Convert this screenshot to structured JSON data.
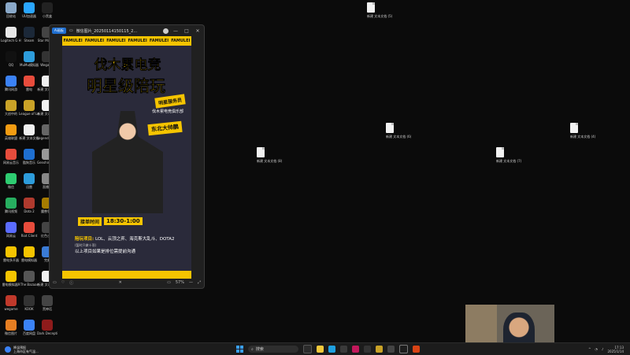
{
  "desktop": {
    "left_icons": [
      {
        "label": "回收站",
        "color": "#8aa9c9"
      },
      {
        "label": "UU加速器",
        "color": "#2aa6ff"
      },
      {
        "label": "小黑盒",
        "color": "#222222"
      },
      {
        "label": "Logitech G HUB",
        "color": "#e7e7e7"
      },
      {
        "label": "Steam",
        "color": "#1b2838"
      },
      {
        "label": "Star Millions",
        "color": "#444444"
      },
      {
        "label": "QQ",
        "color": "#111111"
      },
      {
        "label": "MuMu模拟器",
        "color": "#2d9cdb"
      },
      {
        "label": "Wegame",
        "color": "#333333"
      },
      {
        "label": "腾讯网游",
        "color": "#3b82f6"
      },
      {
        "label": "雷电",
        "color": "#e74c3c"
      },
      {
        "label": "新建 文本文档",
        "color": "#f0f0f0"
      },
      {
        "label": "大创中的",
        "color": "#c9a227"
      },
      {
        "label": "League of Legends",
        "color": "#c9a227"
      },
      {
        "label": "新建 文本文档",
        "color": "#f0f0f0"
      },
      {
        "label": "英雄联盟",
        "color": "#f39c12"
      },
      {
        "label": "新建 文本文档",
        "color": "#f0f0f0"
      },
      {
        "label": "Legends of Runeterra",
        "color": "#666666"
      },
      {
        "label": "网易云音乐",
        "color": "#e74c3c"
      },
      {
        "label": "酷狗音乐",
        "color": "#1e6fd1"
      },
      {
        "label": "Genshin Guard",
        "color": "#999999"
      },
      {
        "label": "微信",
        "color": "#2ecc71"
      },
      {
        "label": "迅雷",
        "color": "#2d9cdb"
      },
      {
        "label": "直播姬",
        "color": "#888888"
      },
      {
        "label": "腾讯视频",
        "color": "#27ae60"
      },
      {
        "label": "Dota 2",
        "color": "#b03a2e"
      },
      {
        "label": "魔兽争霸",
        "color": "#a67c00"
      },
      {
        "label": "网易云",
        "color": "#5b6cff"
      },
      {
        "label": "Riot Client",
        "color": "#e74c3c"
      },
      {
        "label": "红色沙漠",
        "color": "#444444"
      },
      {
        "label": "雷电多开器",
        "color": "#f5c400"
      },
      {
        "label": "雷电模拟器",
        "color": "#f5c400"
      },
      {
        "label": "完美",
        "color": "#3a7bd5"
      },
      {
        "label": "雷电模拟器9",
        "color": "#f5c400"
      },
      {
        "label": "The Bazaar",
        "color": "#555555"
      },
      {
        "label": "新建 文本文档",
        "color": "#f0f0f0"
      },
      {
        "label": "wegame",
        "color": "#c0392b"
      },
      {
        "label": "KOOK",
        "color": "#333333"
      },
      {
        "label": "黑神话",
        "color": "#444444"
      },
      {
        "label": "微信图片",
        "color": "#e67e22"
      },
      {
        "label": "百度网盘",
        "color": "#3b82f6"
      },
      {
        "label": "Dark Deception",
        "color": "#8e1b1b"
      }
    ],
    "files": [
      {
        "label": "新建 文本文档 (5)"
      },
      {
        "label": "新建 文本文档 (6)"
      },
      {
        "label": "新建 文本文档 (4)"
      },
      {
        "label": "新建 文本文档 (8)"
      },
      {
        "label": "新建 文本文档 (7)"
      }
    ]
  },
  "viewer": {
    "brand": "Ai画板",
    "filename": "微信图片_20250114150115_2...",
    "minimize": "—",
    "maximize": "□",
    "close": "✕",
    "zoom": "57%",
    "poster": {
      "band_text": [
        "FAMULEI",
        "FAMULEI",
        "FAMULEI",
        "FAMULEI",
        "FAMULEI",
        "FAMULEI"
      ],
      "title1": "伐木累电竞",
      "title2": "明星级陪玩",
      "tag": "明星服务员",
      "tag2": "伐木累电竞俱乐部",
      "badge": "东北大帅鹏",
      "time_label": "接单时间",
      "time_value": "18:30-1:00",
      "info_label": "陪玩项目:",
      "info_text": "LOL、云顶之弈、海克斯大乱斗、DOTA2",
      "info_note": "(暂时只做十项)",
      "footer_text": "以上项目如果是排位需提前沟通"
    }
  },
  "taskbar": {
    "weather_title": "降温预报",
    "weather_sub": "上海市区有气温...",
    "search_placeholder": "搜索",
    "time": "17:13",
    "date": "2025/1/14"
  }
}
